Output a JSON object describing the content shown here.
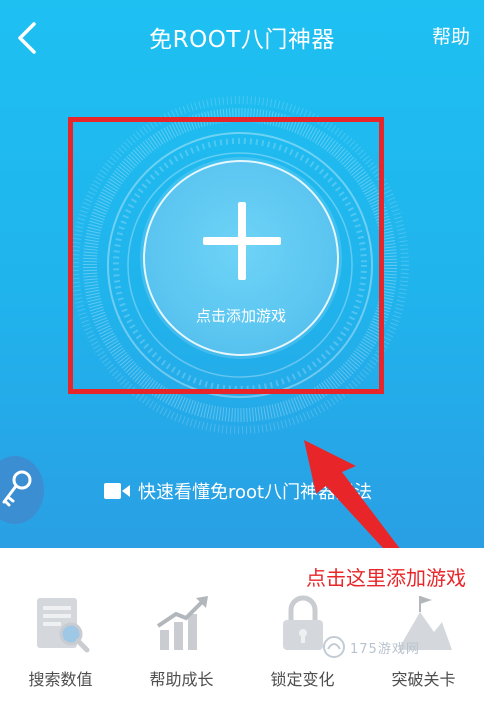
{
  "header": {
    "title": "免ROOT八门神器",
    "help_label": "帮助"
  },
  "main": {
    "add_game_label": "点击添加游戏",
    "video_link_label": "快速看懂免root八门神器用法"
  },
  "annotation": {
    "text": "点击这里添加游戏"
  },
  "features": [
    {
      "label": "搜索数值",
      "icon": "search-document-icon"
    },
    {
      "label": "帮助成长",
      "icon": "growth-chart-icon"
    },
    {
      "label": "锁定变化",
      "icon": "lock-icon"
    },
    {
      "label": "突破关卡",
      "icon": "mountain-flag-icon"
    }
  ],
  "watermark": {
    "text": "175游戏网"
  },
  "colors": {
    "accent_blue": "#1ec0f2",
    "annotation_red": "#e8262a",
    "feature_gray": "#c9ccd0"
  }
}
